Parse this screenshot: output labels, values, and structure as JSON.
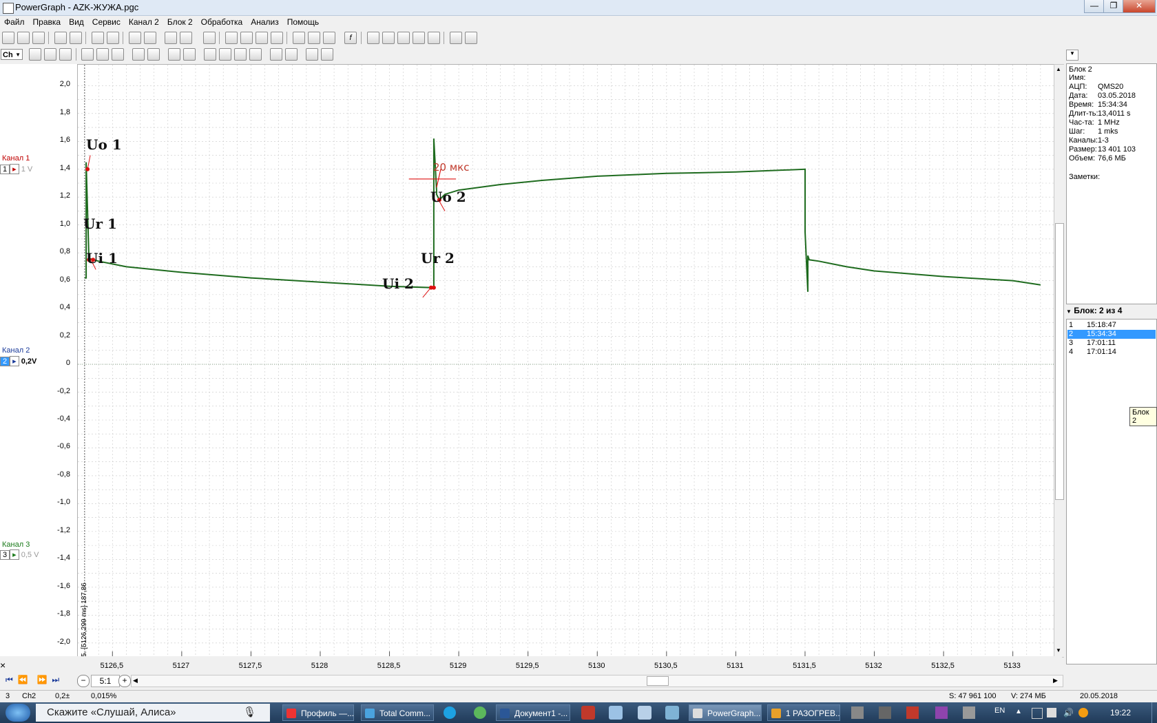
{
  "window": {
    "title": "PowerGraph - AZK-ЖУЖА.pgc",
    "minimize": "—",
    "maximize": "❐",
    "close": "✕"
  },
  "menu": [
    "Файл",
    "Правка",
    "Вид",
    "Сервис",
    "Канал 2",
    "Блок 2",
    "Обработка",
    "Анализ",
    "Помощь"
  ],
  "toolbar2": {
    "channel_selector": "Ch"
  },
  "channels": [
    {
      "label": "Канал 1",
      "num": "1",
      "scale": "1 V",
      "color": "#c00000"
    },
    {
      "label": "Канал 2",
      "num": "2",
      "scale": "0,2V",
      "color": "#1a3a9a"
    },
    {
      "label": "Канал 3",
      "num": "3",
      "scale": "0,5 V",
      "color": "#1a7a1a"
    }
  ],
  "y_ticks": [
    "2,0",
    "1,8",
    "1,6",
    "1,4",
    "1,2",
    "1,0",
    "0,8",
    "0,6",
    "0,4",
    "0,2",
    "0",
    "-0,2",
    "-0,4",
    "-0,6",
    "-0,8",
    "-1,0",
    "-1,2",
    "-1,4",
    "-1,6",
    "-1,8",
    "-2,0"
  ],
  "cursor_label": "5. [5126,299 ms] 187,86",
  "chart_data": {
    "type": "line",
    "title": "",
    "xlabel": "",
    "ylabel": "",
    "xlim": [
      5126.25,
      5133.3
    ],
    "ylim": [
      -2.1,
      2.15
    ],
    "x_ticks": [
      "5126,5",
      "5127",
      "5127,5",
      "5128",
      "5128,5",
      "5129",
      "5129,5",
      "5130",
      "5130,5",
      "5131",
      "5131,5",
      "5132",
      "5132,5",
      "5133"
    ],
    "series": [
      {
        "color": "#1e6b1e",
        "x": [
          5126.3,
          5126.31,
          5126.31,
          5126.33,
          5126.4,
          5126.6,
          5127.0,
          5127.5,
          5128.0,
          5128.5,
          5128.82,
          5128.82,
          5128.84,
          5128.84,
          5128.86,
          5128.9,
          5129.0,
          5129.3,
          5129.6,
          5130.0,
          5130.5,
          5131.0,
          5131.5,
          5131.5,
          5131.52,
          5131.52,
          5131.53,
          5131.6,
          5131.8,
          5132.0,
          5132.5,
          5133.0,
          5133.2
        ],
        "y": [
          0.62,
          0.62,
          1.45,
          0.76,
          0.74,
          0.7,
          0.66,
          0.62,
          0.59,
          0.56,
          0.55,
          1.62,
          1.25,
          1.22,
          1.18,
          1.22,
          1.25,
          1.29,
          1.32,
          1.35,
          1.37,
          1.38,
          1.4,
          0.95,
          0.52,
          0.78,
          0.75,
          0.74,
          0.7,
          0.67,
          0.63,
          0.6,
          0.57
        ]
      }
    ],
    "grid": true
  },
  "annotations": {
    "uo1": "Uo 1",
    "ur1": "Ur 1",
    "ui1": "Ui 1",
    "uo2": "Uo 2",
    "ur2": "Ur 2",
    "ui2": "Ui 2",
    "time": "20 мкс"
  },
  "info": {
    "block": "Блок 2",
    "rows": [
      [
        "Имя:",
        ""
      ],
      [
        "АЦП:",
        "QMS20"
      ],
      [
        "Дата:",
        "03.05.2018"
      ],
      [
        "Время:",
        "15:34:34"
      ],
      [
        "Длит-ть:",
        "13,4011 s"
      ],
      [
        "Час-та:",
        "1 MHz"
      ],
      [
        "Шаг:",
        "1 mks"
      ],
      [
        "Каналы:",
        "1-3"
      ],
      [
        "Размер:",
        "13 401 103"
      ],
      [
        "Объем:",
        "76,6 МБ"
      ]
    ],
    "notes": "Заметки:"
  },
  "blocks": {
    "header": "Блок: 2 из 4",
    "items": [
      [
        "1",
        "15:18:47"
      ],
      [
        "2",
        "15:34:34"
      ],
      [
        "3",
        "17:01:11"
      ],
      [
        "4",
        "17:01:14"
      ]
    ],
    "selected": 1,
    "tooltip": "Блок 2"
  },
  "bottom_controls": {
    "close": "×",
    "zoom_ratio": "5:1"
  },
  "status": {
    "block": "3",
    "channel": "Ch2",
    "value": "0,2±",
    "percent": "0,015%",
    "samples": "S: 47 961 100",
    "volume": "V: 274 МБ",
    "date": "20.05.2018"
  },
  "taskbar": {
    "search": "Скажите «Слушай, Алиса»",
    "tasks": [
      "Профиль —...",
      "Total Comm...",
      "Документ1 -...",
      "PowerGraph...",
      "1 РАЗОГРЕВ..."
    ],
    "lang": "EN",
    "clock": "19:22"
  }
}
